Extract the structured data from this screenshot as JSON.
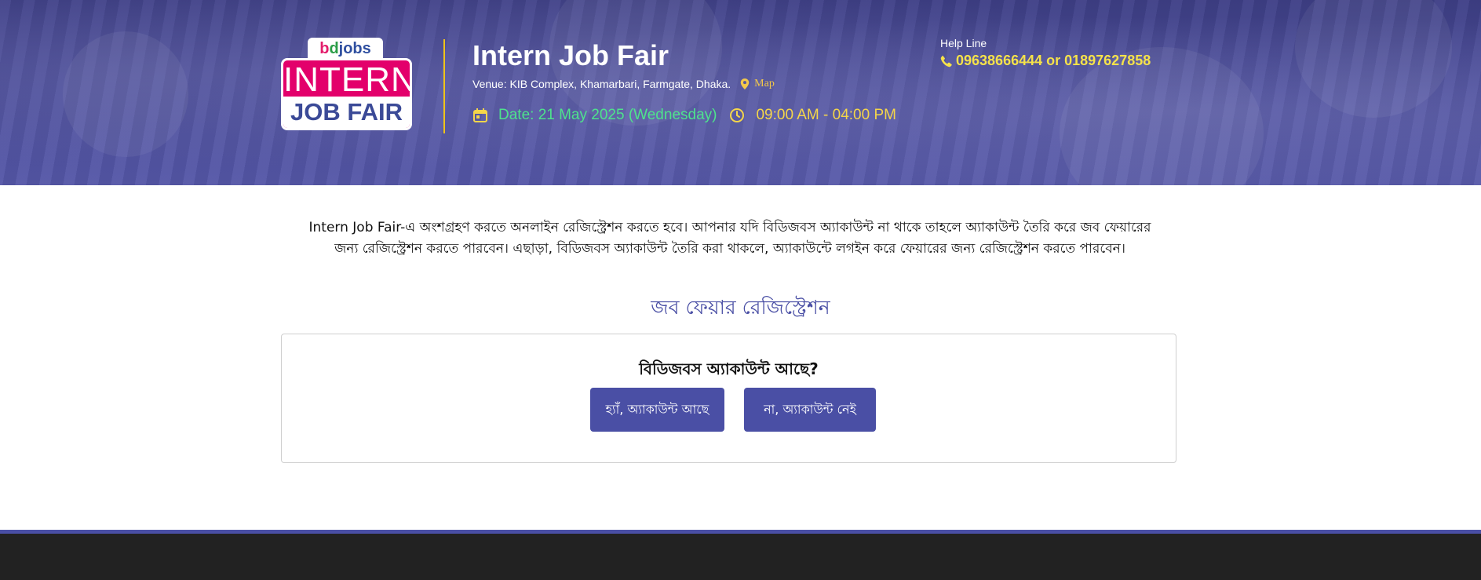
{
  "logo": {
    "brand_part1": "b",
    "brand_part2": "d",
    "brand_part3": "jobs",
    "line1": "INTERN",
    "line2": "JOB FAIR"
  },
  "header": {
    "title": "Intern Job Fair",
    "venue": "Venue: KIB Complex, Khamarbari, Farmgate, Dhaka.",
    "map_label": "Map",
    "date": "Date: 21 May 2025 (Wednesday)",
    "time": "09:00 AM - 04:00 PM",
    "help_label": "Help Line",
    "help_phones": "09638666444 or 01897627858"
  },
  "colors": {
    "accent": "#4a4fa5",
    "date_green": "#4ee38c",
    "time_yellow": "#f5d64a",
    "logo_pink": "#e3006b",
    "divider_gold": "#f0c419"
  },
  "icons": {
    "venue": "map-pin-icon",
    "date": "calendar-icon",
    "time": "clock-icon",
    "help": "phone-icon"
  },
  "main": {
    "intro": "Intern Job Fair-এ অংশগ্রহণ করতে অনলাইন রেজিস্ট্রেশন করতে হবে। আপনার যদি বিডিজবস অ্যাকাউন্ট না থাকে তাহলে অ্যাকাউন্ট তৈরি করে জব ফেয়ারের জন্য রেজিস্ট্রেশন করতে পারবেন। এছাড়া, বিডিজবস অ্যাকাউন্ট তৈরি করা থাকলে, অ্যাকাউন্টে লগইন করে ফেয়ারের জন্য রেজিস্ট্রেশন করতে পারবেন।",
    "registration_title": "জব ফেয়ার রেজিস্ট্রেশন",
    "question": "বিডিজবস অ্যাকাউন্ট আছে?",
    "yes_button": "হ্যাঁ, অ্যাকাউন্ট আছে",
    "no_button": "না, অ্যাকাউন্ট নেই"
  }
}
